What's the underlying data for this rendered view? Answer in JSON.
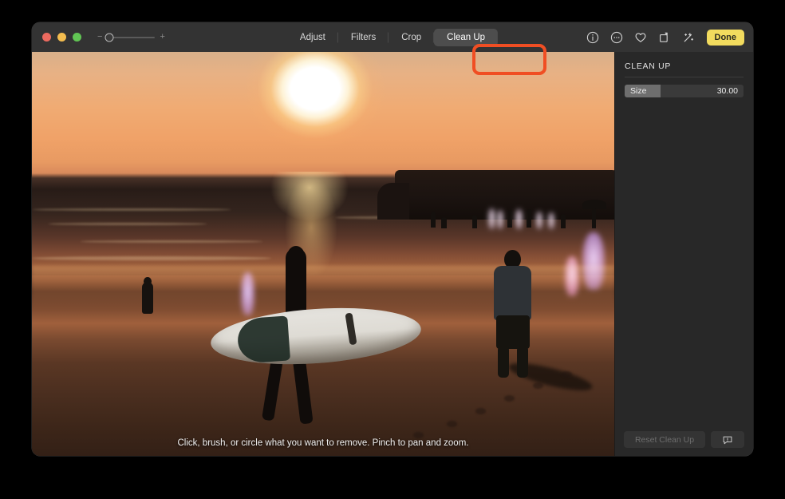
{
  "window": {
    "traffic_lights": [
      "close",
      "minimize",
      "maximize"
    ],
    "zoom_slider": {
      "minus": "−",
      "plus": "+",
      "position_pct": 5
    }
  },
  "tabs": [
    {
      "label": "Adjust",
      "active": false
    },
    {
      "label": "Filters",
      "active": false
    },
    {
      "label": "Crop",
      "active": false
    },
    {
      "label": "Clean Up",
      "active": true
    }
  ],
  "title_actions": {
    "icons": [
      "info-icon",
      "markup-icon",
      "favorite-heart-icon",
      "rotate-icon",
      "auto-enhance-icon"
    ],
    "done_label": "Done"
  },
  "canvas": {
    "hint": "Click, brush, or circle what you want to remove. Pinch to pan and zoom."
  },
  "sidebar": {
    "title": "CLEAN UP",
    "size_control": {
      "label": "Size",
      "value": "30.00",
      "fill_pct": 30
    },
    "reset_label": "Reset Clean Up",
    "feedback_icon": "feedback-bubble-icon"
  },
  "annotation": {
    "target": "Clean Up",
    "color": "#f04e23"
  }
}
